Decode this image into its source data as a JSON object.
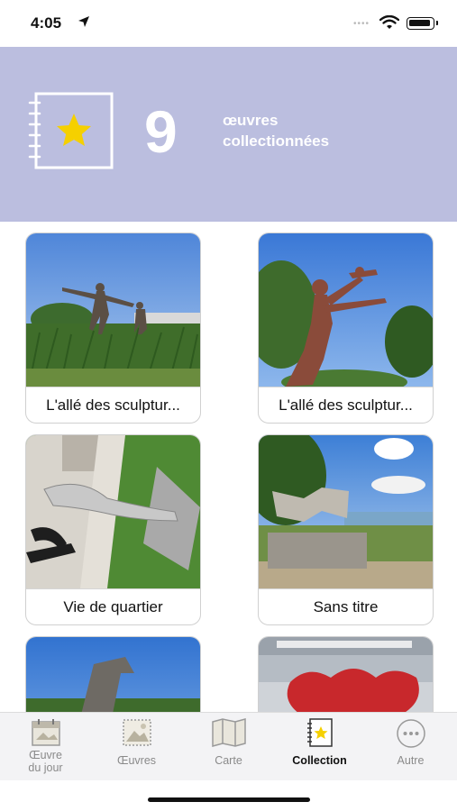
{
  "status_bar": {
    "time": "4:05"
  },
  "header": {
    "count": "9",
    "label_line1": "œuvres",
    "label_line2": "collectionnées",
    "accent_color": "#bbbedf",
    "icon": "star-notebook-icon"
  },
  "collection": {
    "items": [
      {
        "title": "L'allé des sculptur..."
      },
      {
        "title": "L'allé des sculptur..."
      },
      {
        "title": "Vie de quartier"
      },
      {
        "title": "Sans titre"
      },
      {
        "title": ""
      },
      {
        "title": ""
      }
    ]
  },
  "tabbar": {
    "tabs": [
      {
        "label": "Œuvre du jour",
        "icon": "calendar-icon"
      },
      {
        "label": "Œuvres",
        "icon": "artwork-icon"
      },
      {
        "label": "Carte",
        "icon": "map-icon"
      },
      {
        "label": "Collection",
        "icon": "star-notebook-icon",
        "active": true
      },
      {
        "label": "Autre",
        "icon": "more-icon"
      }
    ]
  }
}
